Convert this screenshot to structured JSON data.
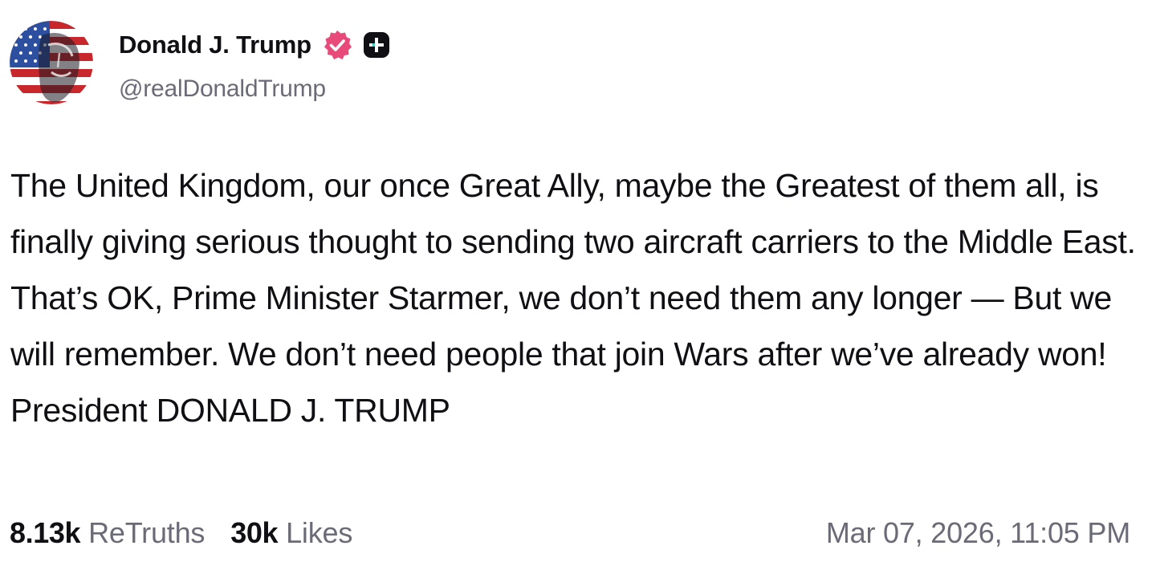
{
  "author": {
    "display_name": "Donald J. Trump",
    "handle": "@realDonaldTrump",
    "avatar_icon": "flag-portrait-avatar",
    "verified_icon": "verified-badge-icon",
    "verified_color": "#e84a7a",
    "plus_icon": "plus-badge-icon",
    "plus_color": "#0f0f14"
  },
  "post": {
    "text": "The United Kingdom, our once Great Ally, maybe the Greatest of them all, is finally giving serious thought to sending two aircraft carriers to the Middle East. That’s OK, Prime Minister Starmer, we don’t need them any longer — But we will remember. We don’t need people that join Wars after we’ve already won! President DONALD J. TRUMP"
  },
  "stats": {
    "retruths_count": "8.13k",
    "retruths_label": "ReTruths",
    "likes_count": "30k",
    "likes_label": "Likes"
  },
  "timestamp": "Mar 07, 2026, 11:05 PM"
}
